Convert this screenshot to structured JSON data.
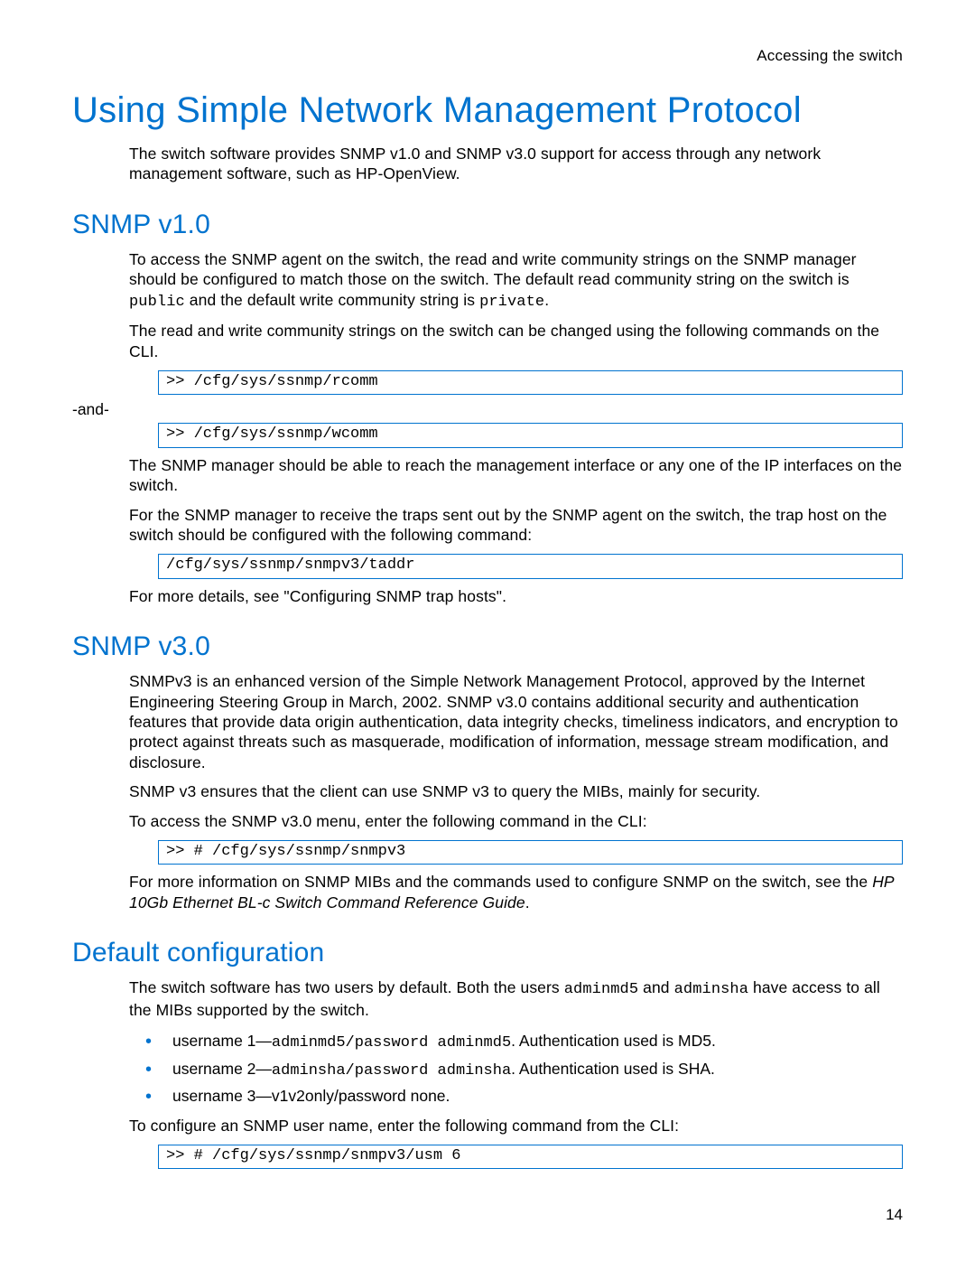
{
  "running_header": "Accessing the switch",
  "title": "Using Simple Network Management Protocol",
  "intro": "The switch software provides SNMP v1.0 and SNMP v3.0 support for access through any network management software, such as HP-OpenView.",
  "s1": {
    "heading": "SNMP v1.0",
    "p1_a": "To access the SNMP agent on the switch, the read and write community strings on the SNMP manager should be configured to match those on the switch. The default read community string on the switch is ",
    "p1_code1": "public",
    "p1_b": " and the default write community string is ",
    "p1_code2": "private",
    "p1_c": ".",
    "p2": "The read and write community strings on the switch can be changed using the following commands on the CLI.",
    "cmd1": ">> /cfg/sys/ssnmp/rcomm",
    "and": "-and-",
    "cmd2": ">> /cfg/sys/ssnmp/wcomm",
    "p3": "The SNMP manager should be able to reach the management interface or any one of the IP interfaces on the switch.",
    "p4": "For the SNMP manager to receive the traps sent out by the SNMP agent on the switch, the trap host on the switch should be configured with the following command:",
    "cmd3": "/cfg/sys/ssnmp/snmpv3/taddr",
    "p5": "For more details, see \"Configuring SNMP trap hosts\"."
  },
  "s2": {
    "heading": "SNMP v3.0",
    "p1": "SNMPv3 is an enhanced version of the Simple Network Management Protocol, approved by the Internet Engineering Steering Group in March, 2002. SNMP v3.0 contains additional security and authentication features that provide data origin authentication, data integrity checks, timeliness indicators, and encryption to protect against threats such as masquerade, modification of information, message stream modification, and disclosure.",
    "p2": "SNMP v3 ensures that the client can use SNMP v3 to query the MIBs, mainly for security.",
    "p3": "To access the SNMP v3.0 menu, enter the following command in the CLI:",
    "cmd1": ">> #  /cfg/sys/ssnmp/snmpv3",
    "p4_a": "For more information on SNMP MIBs and the commands used to configure SNMP on the switch, see the ",
    "p4_i": "HP 10Gb Ethernet BL-c Switch Command Reference Guide",
    "p4_b": "."
  },
  "s3": {
    "heading": "Default configuration",
    "p1_a": "The switch software has two users by default. Both the users ",
    "p1_code1": "adminmd5",
    "p1_b": " and ",
    "p1_code2": "adminsha",
    "p1_c": " have access to all the MIBs supported by the switch.",
    "b1_a": "username 1—",
    "b1_code": "adminmd5/password adminmd5",
    "b1_b": ". Authentication used is MD5.",
    "b2_a": "username 2—",
    "b2_code": "adminsha/password adminsha",
    "b2_b": ". Authentication used is SHA.",
    "b3": "username 3—v1v2only/password none.",
    "p2": "To configure an SNMP user name, enter the following command from the CLI:",
    "cmd1": ">> #  /cfg/sys/ssnmp/snmpv3/usm 6"
  },
  "page_number": "14"
}
